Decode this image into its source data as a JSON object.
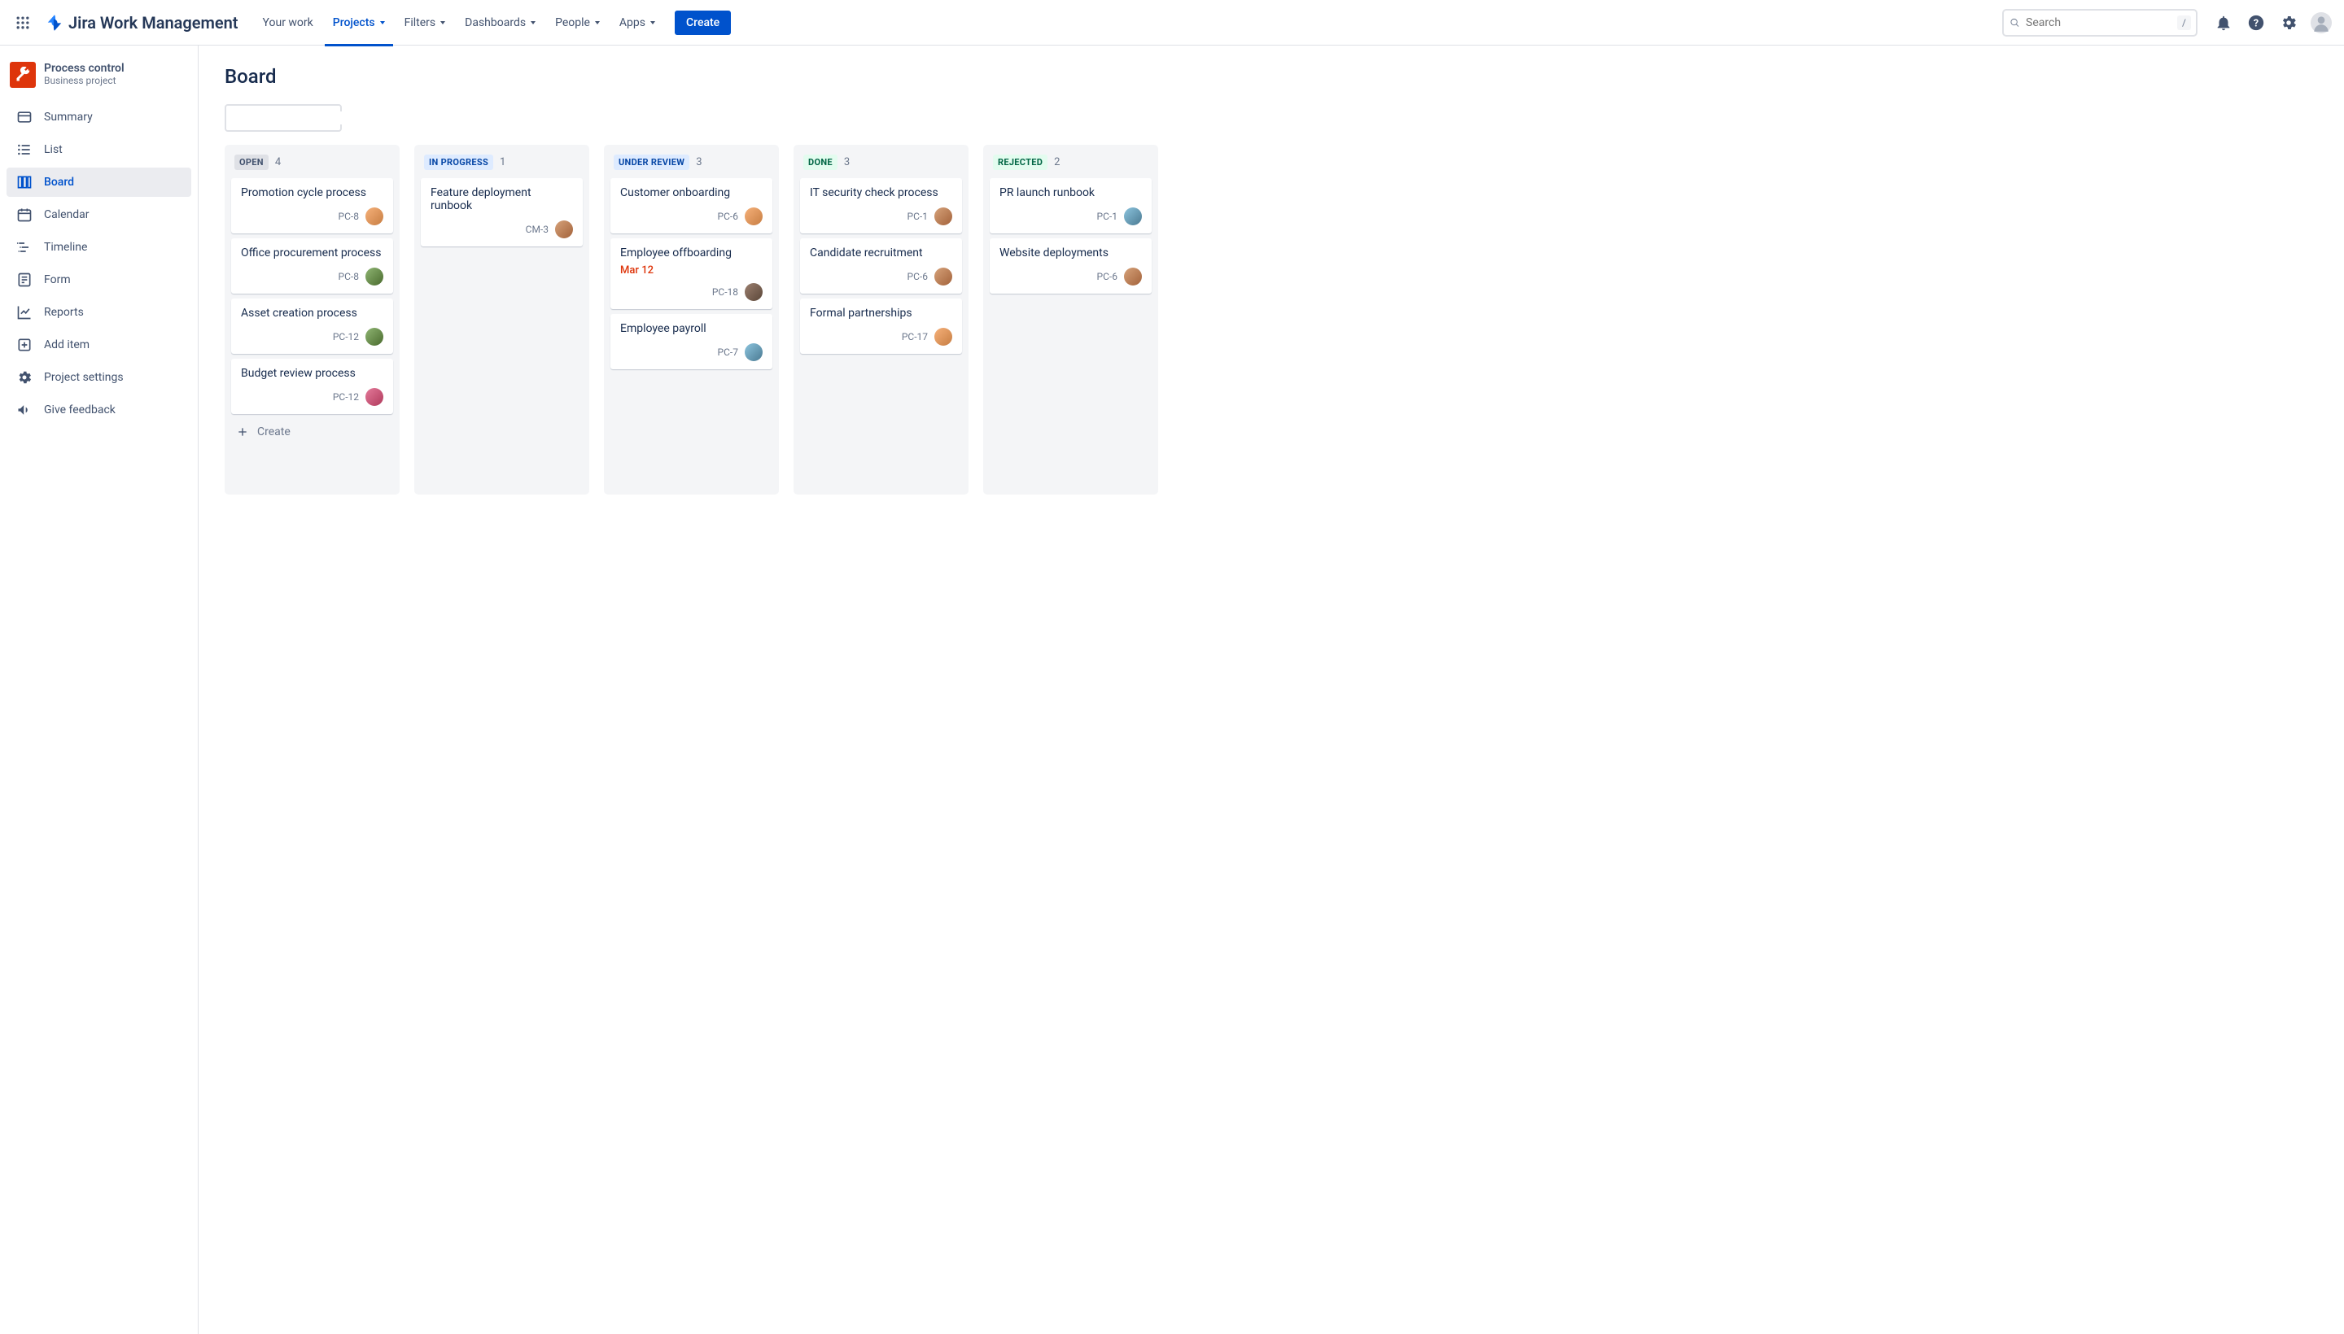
{
  "top_nav": {
    "product_name": "Jira Work Management",
    "items": [
      {
        "label": "Your work",
        "dropdown": false
      },
      {
        "label": "Projects",
        "dropdown": true,
        "active": true
      },
      {
        "label": "Filters",
        "dropdown": true
      },
      {
        "label": "Dashboards",
        "dropdown": true
      },
      {
        "label": "People",
        "dropdown": true
      },
      {
        "label": "Apps",
        "dropdown": true
      }
    ],
    "create_label": "Create",
    "search_placeholder": "Search",
    "search_key": "/"
  },
  "project": {
    "name": "Process control",
    "type": "Business project"
  },
  "sidebar": [
    {
      "id": "summary",
      "label": "Summary"
    },
    {
      "id": "list",
      "label": "List"
    },
    {
      "id": "board",
      "label": "Board",
      "active": true
    },
    {
      "id": "calendar",
      "label": "Calendar"
    },
    {
      "id": "timeline",
      "label": "Timeline"
    },
    {
      "id": "form",
      "label": "Form"
    },
    {
      "id": "reports",
      "label": "Reports"
    },
    {
      "id": "add-item",
      "label": "Add item"
    },
    {
      "id": "project-settings",
      "label": "Project settings"
    },
    {
      "id": "give-feedback",
      "label": "Give feedback"
    }
  ],
  "page": {
    "title": "Board",
    "create_label": "Create"
  },
  "colors": {
    "col_open_bg": "#DFE1E6",
    "col_open_fg": "#42526E",
    "col_inprogress_bg": "#DEEBFF",
    "col_inprogress_fg": "#0747A6",
    "col_underreview_bg": "#DEEBFF",
    "col_underreview_fg": "#0747A6",
    "col_done_bg": "#E3FCEF",
    "col_done_fg": "#006644",
    "col_rejected_bg": "#E3FCEF",
    "col_rejected_fg": "#006644"
  },
  "columns": [
    {
      "id": "open",
      "title": "OPEN",
      "count": "4",
      "cards": [
        {
          "title": "Promotion cycle process",
          "key": "PC-8",
          "avatar": "a1"
        },
        {
          "title": "Office procurement process",
          "key": "PC-8",
          "avatar": "a2"
        },
        {
          "title": "Asset creation process",
          "key": "PC-12",
          "avatar": "a2"
        },
        {
          "title": "Budget review process",
          "key": "PC-12",
          "avatar": "a3"
        }
      ],
      "show_create": true
    },
    {
      "id": "inprogress",
      "title": "IN PROGRESS",
      "count": "1",
      "cards": [
        {
          "title": "Feature deployment runbook",
          "key": "CM-3",
          "avatar": "a4"
        }
      ]
    },
    {
      "id": "underreview",
      "title": "UNDER REVIEW",
      "count": "3",
      "cards": [
        {
          "title": "Customer onboarding",
          "key": "PC-6",
          "avatar": "a1"
        },
        {
          "title": "Employee offboarding",
          "date": "Mar 12",
          "key": "PC-18",
          "avatar": "a5"
        },
        {
          "title": "Employee payroll",
          "key": "PC-7",
          "avatar": "a6"
        }
      ]
    },
    {
      "id": "done",
      "title": "DONE",
      "count": "3",
      "cards": [
        {
          "title": "IT security check process",
          "key": "PC-1",
          "avatar": "a4"
        },
        {
          "title": "Candidate recruitment",
          "key": "PC-6",
          "avatar": "a4"
        },
        {
          "title": "Formal partnerships",
          "key": "PC-17",
          "avatar": "a1"
        }
      ]
    },
    {
      "id": "rejected",
      "title": "REJECTED",
      "count": "2",
      "cards": [
        {
          "title": "PR launch runbook",
          "key": "PC-1",
          "avatar": "a6"
        },
        {
          "title": "Website deployments",
          "key": "PC-6",
          "avatar": "a4"
        }
      ]
    }
  ],
  "avatars": {
    "a1": "linear-gradient(135deg,#f6b17a,#c77d42)",
    "a2": "linear-gradient(135deg,#8fb573,#4a6b2e)",
    "a3": "linear-gradient(135deg,#e47a9a,#b03a5c)",
    "a4": "linear-gradient(135deg,#d6a27a,#a3623a)",
    "a5": "linear-gradient(135deg,#9c8070,#5a4638)",
    "a6": "linear-gradient(135deg,#8cc4de,#4a7a92)"
  }
}
